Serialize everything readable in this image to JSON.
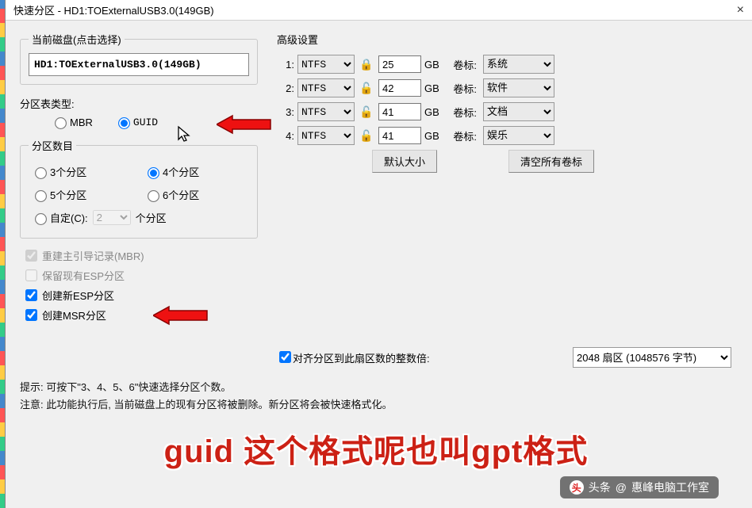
{
  "window": {
    "title": "快速分区 - HD1:TOExternalUSB3.0(149GB)",
    "close": "×"
  },
  "disk_group": {
    "legend": "当前磁盘(点击选择)",
    "value": "HD1:TOExternalUSB3.0(149GB)"
  },
  "pt_type": {
    "label": "分区表类型:",
    "mbr": "MBR",
    "guid": "GUID"
  },
  "count_group": {
    "legend": "分区数目",
    "opt3": "3个分区",
    "opt4": "4个分区",
    "opt5": "5个分区",
    "opt6": "6个分区",
    "custom_label": "自定(C):",
    "custom_value": "2",
    "custom_suffix": "个分区"
  },
  "checks": {
    "rebuild_mbr": "重建主引导记录(MBR)",
    "keep_esp": "保留现有ESP分区",
    "new_esp": "创建新ESP分区",
    "new_msr": "创建MSR分区"
  },
  "adv": {
    "legend": "高级设置",
    "gb": "GB",
    "vol_label": "卷标:",
    "rows": [
      {
        "idx": "1:",
        "fs": "NTFS",
        "lock": "closed",
        "size": "25",
        "label": "系统"
      },
      {
        "idx": "2:",
        "fs": "NTFS",
        "lock": "open",
        "size": "42",
        "label": "软件"
      },
      {
        "idx": "3:",
        "fs": "NTFS",
        "lock": "open",
        "size": "41",
        "label": "文档"
      },
      {
        "idx": "4:",
        "fs": "NTFS",
        "lock": "open",
        "size": "41",
        "label": "娱乐"
      }
    ],
    "default_btn": "默认大小",
    "clear_btn": "清空所有卷标"
  },
  "align": {
    "check_label": "对齐分区到此扇区数的整数倍:",
    "select_value": "2048 扇区 (1048576 字节)"
  },
  "tips": {
    "line1": "提示: 可按下\"3、4、5、6\"快速选择分区个数。",
    "line2": "注意: 此功能执行后, 当前磁盘上的现有分区将被删除。新分区将会被快速格式化。"
  },
  "subtitle": "guid 这个格式呢也叫gpt格式",
  "badge": {
    "prefix": "头条",
    "at": "@",
    "name": "惠峰电脑工作室"
  },
  "icons": {
    "lock_closed": "🔒",
    "lock_open": "🔓"
  }
}
